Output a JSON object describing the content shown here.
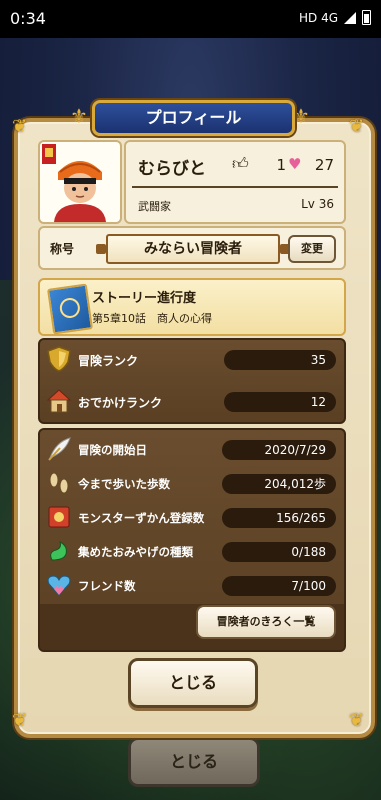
{
  "status_bar": {
    "time": "0:34",
    "network": "HD 4G"
  },
  "panel": {
    "title": "プロフィール"
  },
  "player": {
    "name": "むらびと",
    "likes": "1",
    "hearts": "27",
    "job": "武闘家",
    "level": "Lv 36"
  },
  "title_section": {
    "label": "称号",
    "value": "みならい冒険者",
    "change_button": "変更"
  },
  "story": {
    "label": "ストーリー進行度",
    "chapter": "第5章10話　商人の心得"
  },
  "ranks": [
    {
      "label": "冒険ランク",
      "value": "35",
      "icon": "shield-icon"
    },
    {
      "label": "おでかけランク",
      "value": "12",
      "icon": "house-icon"
    }
  ],
  "stats": [
    {
      "label": "冒険の開始日",
      "value": "2020/7/29",
      "icon": "quill-icon"
    },
    {
      "label": "今まで歩いた歩数",
      "value": "204,012歩",
      "icon": "footprints-icon"
    },
    {
      "label": "モンスターずかん登録数",
      "value": "156/265",
      "icon": "book-icon"
    },
    {
      "label": "集めたおみやげの種類",
      "value": "0/188",
      "icon": "candy-icon"
    },
    {
      "label": "フレンド数",
      "value": "7/100",
      "icon": "friend-heart-icon"
    }
  ],
  "record_button": "冒険者のきろく一覧",
  "close_button": "とじる",
  "close_button_behind": "とじる"
}
